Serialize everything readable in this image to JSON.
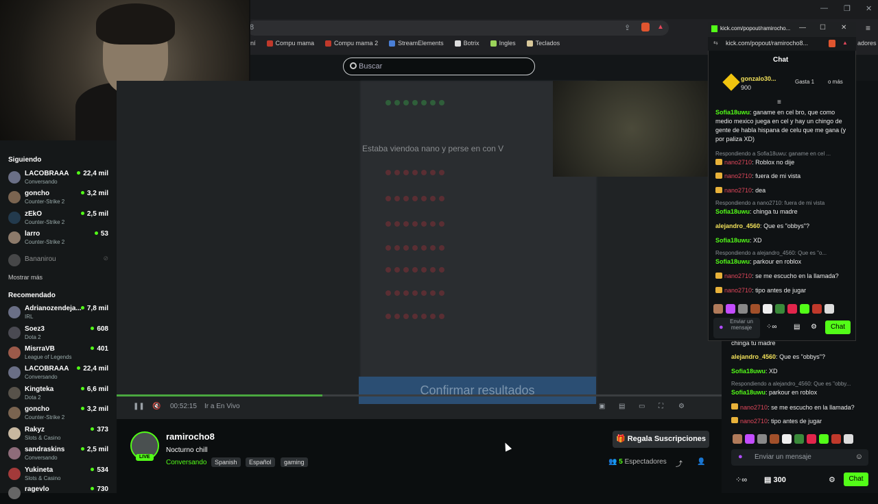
{
  "browser": {
    "url_fragment": "8",
    "bookmarks": [
      "aní",
      "Compu mama",
      "Compu mama 2",
      "StreamElements",
      "Botrix",
      "Ingles",
      "Teclados"
    ],
    "right_extra": "adores"
  },
  "site": {
    "search_placeholder": "Buscar"
  },
  "sidebar": {
    "following_title": "Siguiendo",
    "following": [
      {
        "name": "LACOBRAAA",
        "category": "Conversando",
        "viewers": "22,4 mil"
      },
      {
        "name": "goncho",
        "category": "Counter-Strike 2",
        "viewers": "3,2 mil"
      },
      {
        "name": "zEkO",
        "category": "Counter-Strike 2",
        "viewers": "2,5 mil"
      },
      {
        "name": "larro",
        "category": "Counter-Strike 2",
        "viewers": "53"
      },
      {
        "name": "Bananirou",
        "category": "",
        "viewers": ""
      }
    ],
    "show_more": "Mostrar más",
    "recommended_title": "Recomendado",
    "recommended": [
      {
        "name": "Adrianozendeja...",
        "category": "IRL",
        "viewers": "7,8 mil"
      },
      {
        "name": "Soez3",
        "category": "Dota 2",
        "viewers": "608"
      },
      {
        "name": "MisrraVB",
        "category": "League of Legends",
        "viewers": "401"
      },
      {
        "name": "LACOBRAAA",
        "category": "Conversando",
        "viewers": "22,4 mil"
      },
      {
        "name": "Kingteka",
        "category": "Dota 2",
        "viewers": "6,6 mil"
      },
      {
        "name": "goncho",
        "category": "Counter-Strike 2",
        "viewers": "3,2 mil"
      },
      {
        "name": "Rakyz",
        "category": "Slots & Casino",
        "viewers": "373"
      },
      {
        "name": "sandraskins",
        "category": "Conversando",
        "viewers": "2,5 mil"
      },
      {
        "name": "Yukineta",
        "category": "Slots & Casino",
        "viewers": "534"
      },
      {
        "name": "ragevlo",
        "category": "",
        "viewers": "730"
      }
    ]
  },
  "video": {
    "heading": "Estaba viendoa nano y perse en con V",
    "confirm": "Confirmar resultados",
    "time": "00:52:15",
    "live_link": "Ir a En Vivo",
    "progress": 0.34
  },
  "stream": {
    "streamer": "ramirocho8",
    "live": "LIVE",
    "title": "Nocturno chill",
    "category": "Conversando",
    "tags": [
      "Spanish",
      "Español",
      "gaming"
    ],
    "subs_button": "Regala Suscripciones",
    "viewers_count": "5",
    "viewers_label": "Espectadores"
  },
  "popout": {
    "tab_title": "kick.com/popout/ramirocho...",
    "url": "kick.com/popout/ramirocho8...",
    "chat_title": "Chat",
    "top_user": "gonzalo30...",
    "top_amount": "900",
    "gift_hint": "Gasta 1",
    "gift_hint2": "o más",
    "messages": [
      {
        "type": "msg",
        "user": "Sofia18uwu",
        "color": "g",
        "text": "ganame en cel bro, que como medio mexico juega en cel y hay un chingo de gente de habla hispana de celu que me gana (y por paliza XD)"
      },
      {
        "type": "reply",
        "text": "Respondiendo a Sofia18uwu: ganame en cel ..."
      },
      {
        "type": "msg",
        "user": "nano2710",
        "color": "r",
        "text": "Roblox no dije"
      },
      {
        "type": "msg",
        "user": "nano2710",
        "color": "r",
        "text": "fuera de mi vista"
      },
      {
        "type": "msg",
        "user": "nano2710",
        "color": "r",
        "text": "dea"
      },
      {
        "type": "reply",
        "text": "Respondiendo a nano2710: fuera de mi vista"
      },
      {
        "type": "msg",
        "user": "Sofia18uwu",
        "color": "g",
        "text": "chinga tu madre"
      },
      {
        "type": "msg",
        "user": "alejandro_4560",
        "color": "y",
        "text": "Que es \"obbys\"?"
      },
      {
        "type": "msg",
        "user": "Sofia18uwu",
        "color": "g",
        "text": "XD"
      },
      {
        "type": "reply",
        "text": "Respondiendo a alejandro_4560: Que es \"o..."
      },
      {
        "type": "msg",
        "user": "Sofia18uwu",
        "color": "g",
        "text": "parkour en roblox"
      },
      {
        "type": "msg",
        "user": "nano2710",
        "color": "r",
        "text": "se me escucho en la llamada?"
      },
      {
        "type": "msg",
        "user": "nano2710",
        "color": "r",
        "text": "tipo antes de jugar"
      }
    ],
    "input_placeholder": "Enviar un mensaje",
    "chat_button": "Chat"
  },
  "rightchat": {
    "messages": [
      {
        "user": "",
        "text": "chinga tu madre"
      },
      {
        "user": "alejandro_4560",
        "text": "Que es \"obbys\"?"
      },
      {
        "user": "Sofia18uwu",
        "text": "XD"
      },
      {
        "user": "",
        "text": "Respondiendo a alejandro_4560: Que es \"obby..."
      },
      {
        "user": "Sofia18uwu",
        "text": "parkour en roblox"
      },
      {
        "user": "nano2710",
        "text": "se me escucho en la llamada?"
      },
      {
        "user": "nano2710",
        "text": "tipo antes de jugar"
      }
    ],
    "input_placeholder": "Enviar un mensaje",
    "points": "300",
    "chat_button": "Chat"
  }
}
